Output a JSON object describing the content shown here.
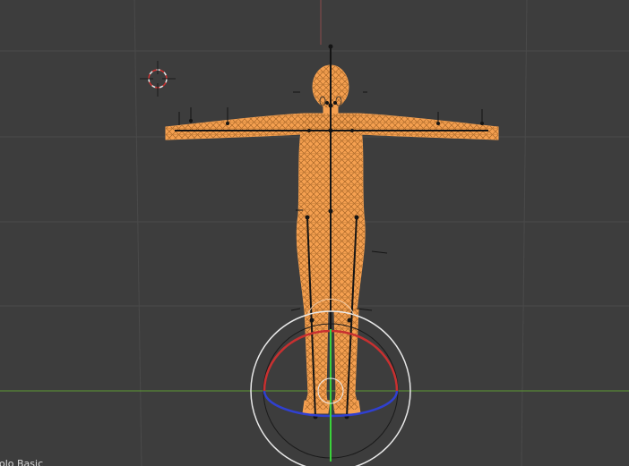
{
  "viewport": {
    "corner_label": "Solo Basic",
    "colors": {
      "background": "#3d3d3d",
      "grid_line": "#4a4a4a",
      "x_axis": "#5d9c32",
      "z_axis": "#8a4a4a",
      "selection": "#f5a050",
      "bone": "#141414",
      "gizmo_red": "#c83030",
      "gizmo_green": "#3ad23a",
      "gizmo_blue": "#3040d0",
      "gizmo_ring": "#e8e8e8",
      "cursor_red": "#d03030"
    },
    "icons": [
      "3d-cursor-icon",
      "rotate-gizmo-icon"
    ]
  }
}
